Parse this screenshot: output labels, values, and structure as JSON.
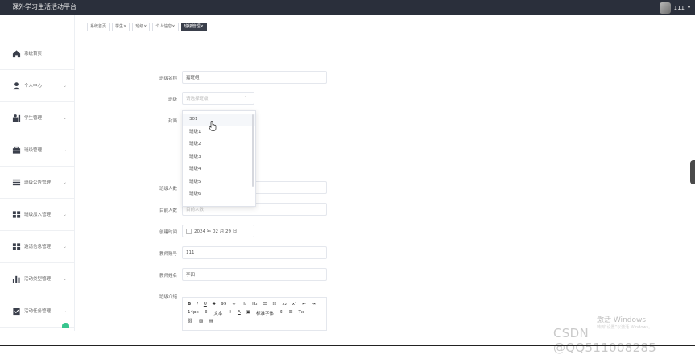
{
  "app": {
    "title": "课外学习生活活动平台",
    "user_name": "111",
    "caret": "▾"
  },
  "sidebar": {
    "items": [
      {
        "label": "系统首页",
        "icon": "home-icon",
        "chevron": ""
      },
      {
        "label": "个人中心",
        "icon": "user-icon",
        "chevron": "⌄"
      },
      {
        "label": "学生管理",
        "icon": "student-icon",
        "chevron": "⌄"
      },
      {
        "label": "班级管理",
        "icon": "briefcase-icon",
        "chevron": "⌄"
      },
      {
        "label": "班级公告管理",
        "icon": "list-icon",
        "chevron": "⌄"
      },
      {
        "label": "班级加入管理",
        "icon": "grid-icon",
        "chevron": "⌄"
      },
      {
        "label": "邀请信息管理",
        "icon": "grid-icon",
        "chevron": "⌄"
      },
      {
        "label": "活动类型管理",
        "icon": "bar-chart-icon",
        "chevron": "⌄"
      },
      {
        "label": "活动任务管理",
        "icon": "clipboard-icon",
        "chevron": "⌄"
      }
    ]
  },
  "tabs": [
    {
      "label": "系统首页",
      "active": false
    },
    {
      "label": "学生×",
      "active": false
    },
    {
      "label": "班级×",
      "active": false
    },
    {
      "label": "个人信息×",
      "active": false
    },
    {
      "label": "班级管理×",
      "active": true
    }
  ],
  "form": {
    "class_name": {
      "label": "班级名称",
      "value": "嘉班组"
    },
    "class": {
      "label": "班级",
      "placeholder": "请选择班级",
      "caret": "⌃"
    },
    "cover": {
      "label": "封面"
    },
    "class_size": {
      "label": "班级人数"
    },
    "current_size": {
      "label": "目前人数",
      "placeholder": "目前人数"
    },
    "created": {
      "label": "创建时间",
      "value": "2024 年 02 月 29 日"
    },
    "teacher_account": {
      "label": "教师账号",
      "value": "111"
    },
    "teacher_name": {
      "label": "教师姓名",
      "value": "李四"
    },
    "intro": {
      "label": "班级介绍"
    }
  },
  "dropdown": {
    "options": [
      "301",
      "班级1",
      "班级2",
      "班级3",
      "班级4",
      "班级5",
      "班级6"
    ]
  },
  "editor": {
    "row1": [
      "B",
      "I",
      "U",
      "S",
      "99",
      "‹›",
      "H₁",
      "H₂",
      "☰",
      "☷",
      "x₂",
      "x²",
      "⇤",
      "⇥"
    ],
    "row2": [
      "14px",
      "⇕",
      "文本",
      "⇕",
      "A",
      "▣",
      "标准字体",
      "⇕",
      "☰",
      "Tx"
    ],
    "row3": [
      "⛓",
      "▨",
      "▤"
    ]
  },
  "watermarks": {
    "windows": "激活 Windows",
    "windows_sub": "转到“设置”以激活 Windows。",
    "csdn": "CSDN @QQ511008285"
  }
}
